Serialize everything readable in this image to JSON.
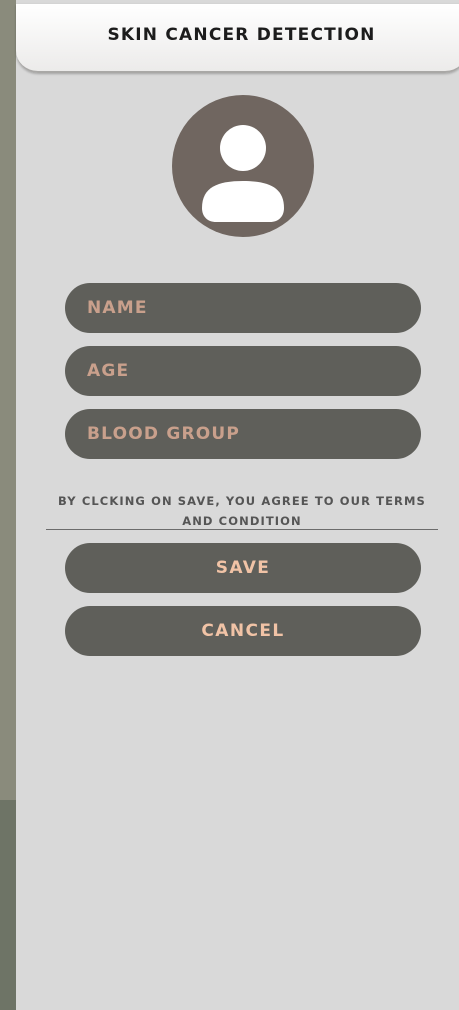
{
  "header": {
    "title": "SKIN CANCER DETECTION"
  },
  "form": {
    "name": {
      "placeholder": "NAME",
      "value": ""
    },
    "age": {
      "placeholder": "AGE",
      "value": ""
    },
    "blood_group": {
      "placeholder": "BLOOD GROUP",
      "value": ""
    }
  },
  "terms": {
    "text": "BY CLCKING ON SAVE, YOU AGREE TO OUR TERMS AND CONDITION"
  },
  "buttons": {
    "save_label": "SAVE",
    "cancel_label": "CANCEL"
  },
  "avatar": {
    "icon": "user-icon"
  },
  "colors": {
    "panel_bg": "#d9d9d9",
    "field_bg": "#5f5f5a",
    "field_text": "#c9a08c",
    "button_text": "#f1c3a6",
    "avatar_bg": "#706660"
  }
}
